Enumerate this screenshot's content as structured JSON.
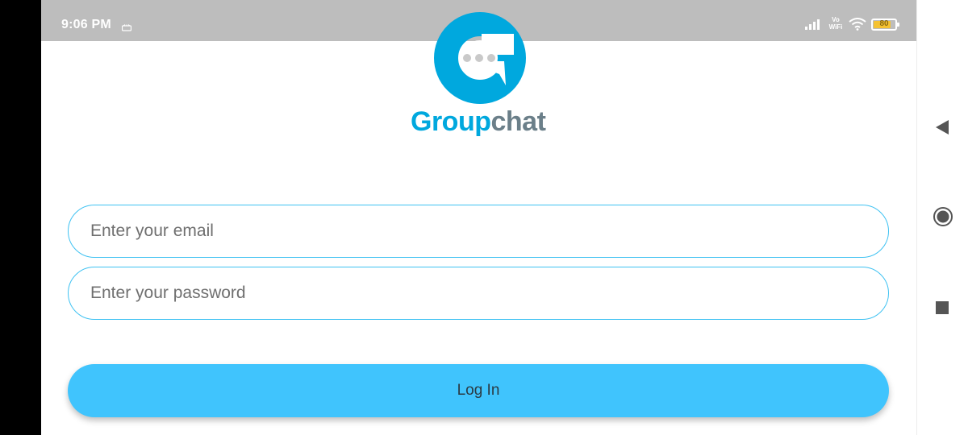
{
  "status_bar": {
    "time": "9:06 PM",
    "network_label": "Vo WiFi",
    "battery_level": "80",
    "battery_fraction": 0.8
  },
  "brand": {
    "part1": "Group",
    "part2": "chat",
    "primary_color": "#00a8de",
    "secondary_color": "#6b7f89"
  },
  "form": {
    "email_placeholder": "Enter your email",
    "password_placeholder": "Enter your password",
    "login_label": "Log In",
    "accent_color": "#40c4fd"
  },
  "nav": {
    "back_icon": "back-triangle-icon",
    "home_icon": "home-circle-icon",
    "recents_icon": "recents-square-icon"
  }
}
